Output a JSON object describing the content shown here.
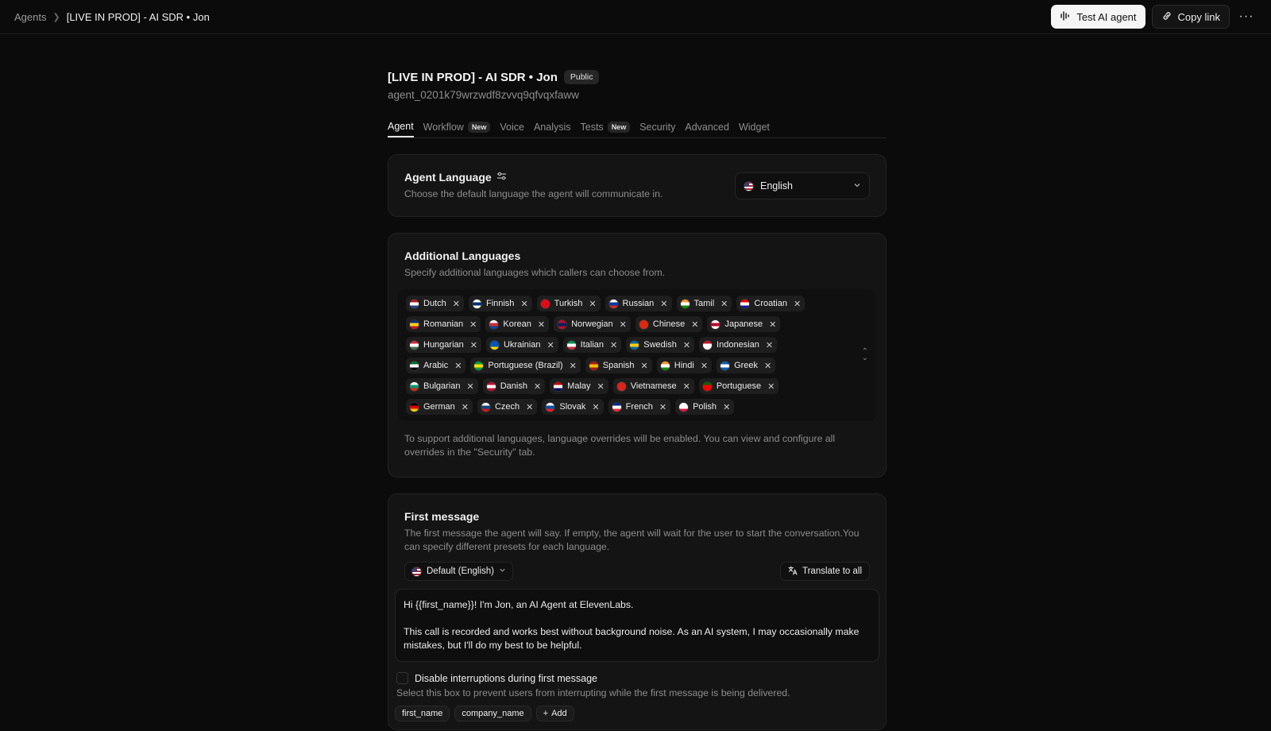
{
  "breadcrumb": {
    "root": "Agents",
    "current": "[LIVE IN PROD] - AI SDR • Jon"
  },
  "header_actions": {
    "test_label": "Test AI agent",
    "copy_label": "Copy link",
    "more_label": "···"
  },
  "agent": {
    "title": "[LIVE IN PROD] - AI SDR • Jon",
    "visibility": "Public",
    "id": "agent_0201k79wrzwdf8zvvq9qfvqxfaww"
  },
  "tabs": [
    {
      "label": "Agent",
      "active": true,
      "badge": ""
    },
    {
      "label": "Workflow",
      "active": false,
      "badge": "New"
    },
    {
      "label": "Voice",
      "active": false,
      "badge": ""
    },
    {
      "label": "Analysis",
      "active": false,
      "badge": ""
    },
    {
      "label": "Tests",
      "active": false,
      "badge": "New"
    },
    {
      "label": "Security",
      "active": false,
      "badge": ""
    },
    {
      "label": "Advanced",
      "active": false,
      "badge": ""
    },
    {
      "label": "Widget",
      "active": false,
      "badge": ""
    }
  ],
  "agent_language": {
    "title": "Agent Language",
    "description": "Choose the default language the agent will communicate in.",
    "selected": "English"
  },
  "additional_languages": {
    "title": "Additional Languages",
    "description": "Specify additional languages which callers can choose from.",
    "languages": [
      {
        "name": "Dutch",
        "colors": [
          "#ae1c28",
          "#ffffff",
          "#21468b"
        ]
      },
      {
        "name": "Finnish",
        "colors": [
          "#ffffff",
          "#002f6c",
          "#ffffff"
        ]
      },
      {
        "name": "Turkish",
        "colors": [
          "#e30a17",
          "#e30a17",
          "#e30a17"
        ]
      },
      {
        "name": "Russian",
        "colors": [
          "#ffffff",
          "#0039a6",
          "#d52b1e"
        ]
      },
      {
        "name": "Tamil",
        "colors": [
          "#ff9933",
          "#ffffff",
          "#138808"
        ]
      },
      {
        "name": "Croatian",
        "colors": [
          "#ff0000",
          "#ffffff",
          "#171796"
        ]
      },
      {
        "name": "Romanian",
        "colors": [
          "#002b7f",
          "#fcd116",
          "#ce1126"
        ]
      },
      {
        "name": "Korean",
        "colors": [
          "#ffffff",
          "#cd2e3a",
          "#0047a0"
        ]
      },
      {
        "name": "Norwegian",
        "colors": [
          "#ba0c2f",
          "#00205b",
          "#ba0c2f"
        ]
      },
      {
        "name": "Chinese",
        "colors": [
          "#de2910",
          "#de2910",
          "#de2910"
        ]
      },
      {
        "name": "Japanese",
        "colors": [
          "#ffffff",
          "#bc002d",
          "#ffffff"
        ]
      },
      {
        "name": "Hungarian",
        "colors": [
          "#ce2939",
          "#ffffff",
          "#477050"
        ]
      },
      {
        "name": "Ukrainian",
        "colors": [
          "#0057b7",
          "#0057b7",
          "#ffd700"
        ]
      },
      {
        "name": "Italian",
        "colors": [
          "#009246",
          "#ffffff",
          "#ce2b37"
        ]
      },
      {
        "name": "Swedish",
        "colors": [
          "#006aa7",
          "#fecc00",
          "#006aa7"
        ]
      },
      {
        "name": "Indonesian",
        "colors": [
          "#ce1126",
          "#ffffff",
          "#ffffff"
        ]
      },
      {
        "name": "Arabic",
        "colors": [
          "#00732f",
          "#ffffff",
          "#000000"
        ]
      },
      {
        "name": "Portuguese (Brazil)",
        "colors": [
          "#009c3b",
          "#ffdf00",
          "#009c3b"
        ]
      },
      {
        "name": "Spanish",
        "colors": [
          "#aa151b",
          "#f1bf00",
          "#aa151b"
        ]
      },
      {
        "name": "Hindi",
        "colors": [
          "#ff9933",
          "#ffffff",
          "#138808"
        ]
      },
      {
        "name": "Greek",
        "colors": [
          "#0d5eaf",
          "#ffffff",
          "#0d5eaf"
        ]
      },
      {
        "name": "Bulgarian",
        "colors": [
          "#ffffff",
          "#00966e",
          "#d62612"
        ]
      },
      {
        "name": "Danish",
        "colors": [
          "#c60c30",
          "#ffffff",
          "#c60c30"
        ]
      },
      {
        "name": "Malay",
        "colors": [
          "#cc0001",
          "#ffffff",
          "#010066"
        ]
      },
      {
        "name": "Vietnamese",
        "colors": [
          "#da251d",
          "#da251d",
          "#da251d"
        ]
      },
      {
        "name": "Portuguese",
        "colors": [
          "#006600",
          "#ff0000",
          "#ff0000"
        ]
      },
      {
        "name": "German",
        "colors": [
          "#000000",
          "#dd0000",
          "#ffce00"
        ]
      },
      {
        "name": "Czech",
        "colors": [
          "#ffffff",
          "#11457e",
          "#d7141a"
        ]
      },
      {
        "name": "Slovak",
        "colors": [
          "#ffffff",
          "#0b4ea2",
          "#ee1c25"
        ]
      },
      {
        "name": "French",
        "colors": [
          "#002395",
          "#ffffff",
          "#ed2939"
        ]
      },
      {
        "name": "Polish",
        "colors": [
          "#ffffff",
          "#ffffff",
          "#dc143c"
        ]
      }
    ],
    "note": "To support additional languages, language overrides will be enabled. You can view and configure all overrides in the \"Security\" tab."
  },
  "first_message": {
    "title": "First message",
    "description": "The first message the agent will say. If empty, the agent will wait for the user to start the conversation.You can specify different presets for each language.",
    "preset": "Default (English)",
    "translate_label": "Translate to all",
    "text_line1": "Hi {{first_name}}! I'm Jon, an AI Agent at ElevenLabs.",
    "text_line2": "This call is recorded and works best without background noise. As an AI system, I may occasionally make mistakes, but I'll do my best to be helpful.",
    "disable_interruptions_label": "Disable interruptions during first message",
    "disable_interruptions_desc": "Select this box to prevent users from interrupting while the first message is being delivered.",
    "variables": [
      "first_name",
      "company_name"
    ],
    "add_label": "Add"
  }
}
